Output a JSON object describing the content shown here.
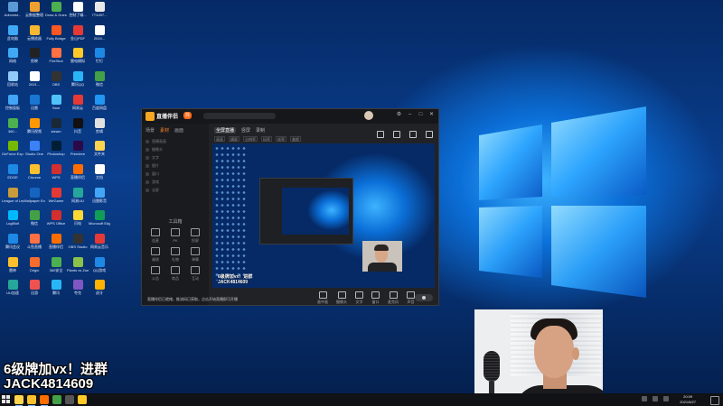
{
  "desktop": {
    "icons": [
      {
        "label": "Administ...",
        "color": "#5b9bd5"
      },
      {
        "label": "云数据整理",
        "color": "#f0a030"
      },
      {
        "label": "Draw & Guess",
        "color": "#4caf50"
      },
      {
        "label": "控制了精...",
        "color": "#ffffff"
      },
      {
        "label": "7T4497...",
        "color": "#e8e8e8"
      },
      {
        "label": "此电脑",
        "color": "#3fa9f5"
      },
      {
        "label": "云播放器",
        "color": "#f7b731"
      },
      {
        "label": "Fully Bridge",
        "color": "#ff5722"
      },
      {
        "label": "金山PDF",
        "color": "#e53935"
      },
      {
        "label": "2019...",
        "color": "#ffffff"
      },
      {
        "label": "网络",
        "color": "#3fa9f5"
      },
      {
        "label": "剪映",
        "color": "#222222"
      },
      {
        "label": "FireShot",
        "color": "#ff7043"
      },
      {
        "label": "雷电模拟",
        "color": "#ffca28"
      },
      {
        "label": "钉钉",
        "color": "#1e88e5"
      },
      {
        "label": "回收站",
        "color": "#90caf9"
      },
      {
        "label": "2021...",
        "color": "#ffffff"
      },
      {
        "label": "OBS",
        "color": "#333333"
      },
      {
        "label": "腾讯QQ",
        "color": "#29b6f6"
      },
      {
        "label": "微信",
        "color": "#43a047"
      },
      {
        "label": "控制面板",
        "color": "#42a5f5"
      },
      {
        "label": "迅雷",
        "color": "#1976d2"
      },
      {
        "label": "Sam",
        "color": "#4fc3f7"
      },
      {
        "label": "网易云",
        "color": "#e53935"
      },
      {
        "label": "百度网盘",
        "color": "#2196f3"
      },
      {
        "label": "360...",
        "color": "#4caf50"
      },
      {
        "label": "腾讯视频",
        "color": "#ff9800"
      },
      {
        "label": "steam",
        "color": "#1b2838"
      },
      {
        "label": "抖音",
        "color": "#111111"
      },
      {
        "label": "剪辑",
        "color": "#e0e0e0"
      },
      {
        "label": "GeForce Experience",
        "color": "#76b900"
      },
      {
        "label": "Studio One",
        "color": "#3b82f6"
      },
      {
        "label": "Photoshop",
        "color": "#001e36"
      },
      {
        "label": "Premiere",
        "color": "#2a0a4a"
      },
      {
        "label": "文件夹",
        "color": "#ffd54f"
      },
      {
        "label": "EDGE",
        "color": "#1e88e5"
      },
      {
        "label": "Chrome",
        "color": "#fbc02d"
      },
      {
        "label": "WPS",
        "color": "#d32f2f"
      },
      {
        "label": "直播伴侣",
        "color": "#ff6d00"
      },
      {
        "label": "文档",
        "color": "#ffffff"
      },
      {
        "label": "League of Legends",
        "color": "#c89b3c"
      },
      {
        "label": "Wallpaper Engine",
        "color": "#1565c0"
      },
      {
        "label": "WeGame",
        "color": "#e53935"
      },
      {
        "label": "网易UU",
        "color": "#26a69a"
      },
      {
        "label": "迅雷影音",
        "color": "#42a5f5"
      },
      {
        "label": "LogiBolt",
        "color": "#00b8fc"
      },
      {
        "label": "微信",
        "color": "#43a047"
      },
      {
        "label": "WPS Office",
        "color": "#d32f2f"
      },
      {
        "label": "闪电",
        "color": "#fdd835"
      },
      {
        "label": "Microsoft Edge",
        "color": "#0f9d58"
      },
      {
        "label": "腾讯会议",
        "color": "#1e88e5"
      },
      {
        "label": "斗鱼直播",
        "color": "#ff7043"
      },
      {
        "label": "直播伴侣",
        "color": "#ff6d00"
      },
      {
        "label": "OBS Studio",
        "color": "#333333"
      },
      {
        "label": "网易云音乐",
        "color": "#e53935"
      },
      {
        "label": "雷神",
        "color": "#fbc02d"
      },
      {
        "label": "Origin",
        "color": "#f56c2d"
      },
      {
        "label": "360安全",
        "color": "#4caf50"
      },
      {
        "label": "Plants vs Zombie",
        "color": "#8bc34a"
      },
      {
        "label": "QQ游戏",
        "color": "#1e88e5"
      },
      {
        "label": "UU加速",
        "color": "#26a69a"
      },
      {
        "label": "迅游",
        "color": "#ef5350"
      },
      {
        "label": "腾讯",
        "color": "#29b6f6"
      },
      {
        "label": "夸克",
        "color": "#7e57c2"
      },
      {
        "label": "虎牙",
        "color": "#ffb300"
      }
    ]
  },
  "app": {
    "name": "直播伴侣",
    "badge": "抖",
    "left_tabs": [
      "场景",
      "素材",
      "画面"
    ],
    "list_items": [
      "直播画面",
      "摄像头",
      "文字",
      "图片",
      "窗口",
      "游戏",
      "全屏"
    ],
    "tools_title": "工具箱",
    "tools": [
      "连麦",
      "PK",
      "投屏",
      "福袋",
      "礼物",
      "弹幕",
      "公告",
      "商品",
      "互动"
    ],
    "main_tabs": [
      "全屏直播",
      "竖屏",
      "录制"
    ],
    "sub_tabs": [
      "画面",
      "横屏",
      "分辨率",
      "码率",
      "帧率",
      "美颜"
    ],
    "bottom_tools": [
      "画中画",
      "摄像头",
      "文字",
      "窗口",
      "麦克风",
      "声音"
    ],
    "status_text": "直播伴侣已就绪，推流码已获取，点击开始直播即可开播"
  },
  "overlay": {
    "line1": "6级牌加vx！进群",
    "line2": "JACK4814609",
    "preview_line1": "6级牌加vx！进群",
    "preview_line2": "JACK4814609"
  },
  "taskbar": {
    "clock_time": "20:09",
    "clock_date": "2021/8/27",
    "apps": [
      {
        "name": "explorer",
        "color": "#ffd54f"
      },
      {
        "name": "chrome",
        "color": "#fbc02d"
      },
      {
        "name": "douyin-live",
        "color": "#ff6d00"
      },
      {
        "name": "wechat",
        "color": "#43a047"
      },
      {
        "name": "obs",
        "color": "#555555"
      },
      {
        "name": "folder",
        "color": "#ffca28"
      }
    ]
  }
}
